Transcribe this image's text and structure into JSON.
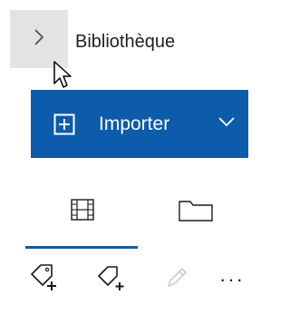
{
  "header": {
    "title": "Bibliothèque",
    "expand_icon": "chevron-right-icon"
  },
  "import_button": {
    "label": "Importer",
    "icon": "add-box-icon",
    "dropdown_icon": "chevron-down-icon",
    "color": "#0d5cab"
  },
  "tabs": [
    {
      "icon": "film-strip-icon",
      "selected": true
    },
    {
      "icon": "folder-icon",
      "selected": false
    }
  ],
  "toolbar": {
    "items": [
      {
        "icon": "tag-add-icon",
        "enabled": true
      },
      {
        "icon": "tag-add-outline-icon",
        "enabled": true
      },
      {
        "icon": "pencil-icon",
        "enabled": false
      },
      {
        "icon": "more-icon",
        "label": "···",
        "enabled": true
      }
    ]
  }
}
